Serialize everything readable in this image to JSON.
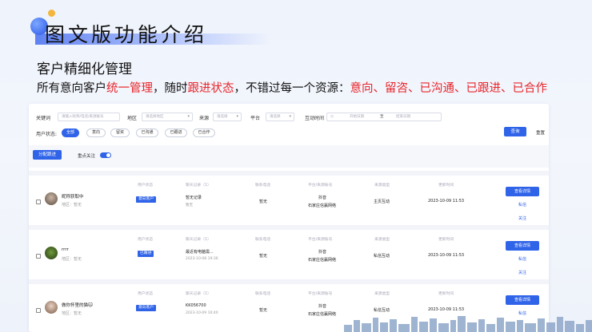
{
  "slide": {
    "title": "图文版功能介绍",
    "subtitle": "客户精细化管理",
    "desc": {
      "p1": "所有意向客户",
      "r1": "统一管理",
      "p2": "，随时",
      "r2": "跟进状态",
      "p3": "，不错过每一个资源：",
      "r3": "意向、留咨、已沟通、已跟进、已合作"
    }
  },
  "filters": {
    "keyword_label": "关键词",
    "keyword_placeholder": "请输入昵称/电话/来源账号",
    "region_label": "地区",
    "region_placeholder": "请选择地区",
    "source_label": "来源",
    "source_placeholder": "请选择",
    "platform_label": "平台",
    "platform_placeholder": "请选择",
    "time_label": "互动时间",
    "start_placeholder": "开始日期",
    "to": "至",
    "end_placeholder": "结束日期",
    "status_label": "用户状态:",
    "status_options": [
      "全部",
      "意向",
      "留资",
      "已沟通",
      "已跟进",
      "已合作"
    ],
    "query": "查询",
    "reset": "重置"
  },
  "toolbar": {
    "assign": "分配跟进",
    "focus": "重点关注"
  },
  "columns": {
    "status": "用户状态",
    "chat": "聊天记录（1）",
    "phone": "联系电话",
    "platform": "平台/来源账号",
    "source_type": "来源类型",
    "updated": "更新时间"
  },
  "rows": [
    {
      "name": "昵称获取中",
      "region": "地区：暂无",
      "status": "意向客户",
      "chat_title": "暂无记录",
      "chat_sub": "暂无",
      "phone": "暂无",
      "platform": "抖音",
      "account": "石家庄信赢网络",
      "source_type": "主页互动",
      "updated": "2023-10-09 11:53",
      "detail": "查看详情",
      "privmsg": "私信",
      "follow": "关注"
    },
    {
      "name": "rrrr",
      "region": "地区：暂无",
      "status": "已跟进",
      "chat_title": "最近有电脑需...",
      "chat_sub": "2023-10-08 19:36",
      "phone": "暂无",
      "platform": "抖音",
      "account": "石家庄信赢网络",
      "source_type": "私信互动",
      "updated": "2023-10-09 11:53",
      "detail": "查看详情",
      "privmsg": "私信",
      "follow": "关注"
    },
    {
      "name": "做你怀里的猫🐱",
      "region": "地区：暂无",
      "status": "意向客户",
      "chat_title": "KK056700",
      "chat_sub": "2023-10-09 10:40",
      "phone": "暂无",
      "platform": "抖音",
      "account": "石家庄信赢网络",
      "source_type": "私信互动",
      "updated": "2023-10-09 11:53",
      "detail": "查看详情",
      "privmsg": "私信",
      "follow": ""
    }
  ],
  "colors": {
    "accent": "#2f63e8",
    "highlight": "#e8262a"
  }
}
